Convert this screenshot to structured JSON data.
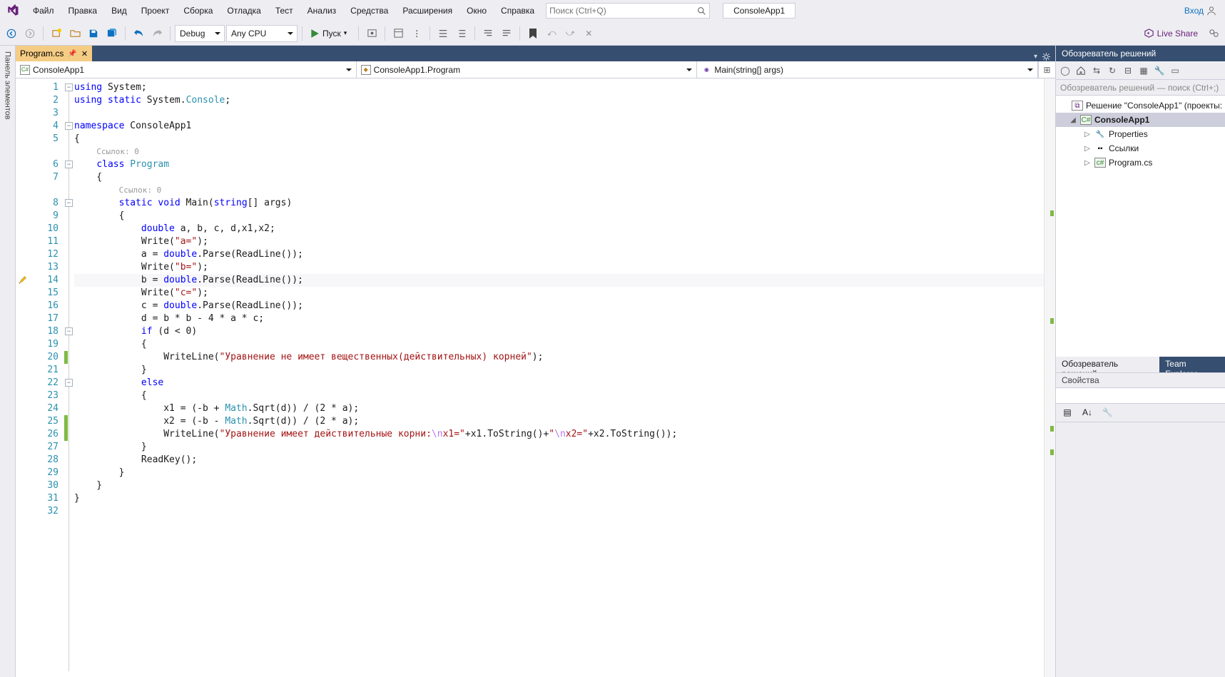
{
  "menu": {
    "items": [
      "Файл",
      "Правка",
      "Вид",
      "Проект",
      "Сборка",
      "Отладка",
      "Тест",
      "Анализ",
      "Средства",
      "Расширения",
      "Окно",
      "Справка"
    ]
  },
  "search": {
    "placeholder": "Поиск (Ctrl+Q)"
  },
  "project_box": "ConsoleApp1",
  "login": "Вход",
  "toolbar": {
    "config": "Debug",
    "platform": "Any CPU",
    "start": "Пуск",
    "liveshare": "Live Share"
  },
  "left_strip": "Панель элементов",
  "tab": {
    "file": "Program.cs"
  },
  "nav": {
    "scope": "ConsoleApp1",
    "class": "ConsoleApp1.Program",
    "member": "Main(string[] args)"
  },
  "codelens": "Ссылок: 0",
  "code_lines": [
    {
      "n": 1,
      "html": "<span class='kw'>using</span> System;"
    },
    {
      "n": 2,
      "html": "<span class='kw'>using</span> <span class='kw'>static</span> System.<span class='type'>Console</span>;"
    },
    {
      "n": 3,
      "html": ""
    },
    {
      "n": 4,
      "html": "<span class='kw'>namespace</span> ConsoleApp1"
    },
    {
      "n": 5,
      "html": "{"
    },
    {
      "n": 0,
      "html": "    <span class='codelens'>Ссылок: 0</span>",
      "lens": true
    },
    {
      "n": 6,
      "html": "    <span class='kw'>class</span> <span class='type'>Program</span>"
    },
    {
      "n": 7,
      "html": "    {"
    },
    {
      "n": 0,
      "html": "        <span class='codelens'>Ссылок: 0</span>",
      "lens": true
    },
    {
      "n": 8,
      "html": "        <span class='kw'>static</span> <span class='kw'>void</span> Main(<span class='kw'>string</span>[] args)"
    },
    {
      "n": 9,
      "html": "        {"
    },
    {
      "n": 10,
      "html": "            <span class='kw'>double</span> a, b, c, d,x1,x2;"
    },
    {
      "n": 11,
      "html": "            Write(<span class='str'>\"a=\"</span>);"
    },
    {
      "n": 12,
      "html": "            a = <span class='kw'>double</span>.Parse(ReadLine());"
    },
    {
      "n": 13,
      "html": "            Write(<span class='str'>\"b=\"</span>);"
    },
    {
      "n": 14,
      "html": "            b = <span class='kw'>double</span>.Parse(ReadLine());",
      "current": true,
      "brush": true
    },
    {
      "n": 15,
      "html": "            Write(<span class='str'>\"c=\"</span>);"
    },
    {
      "n": 16,
      "html": "            c = <span class='kw'>double</span>.Parse(ReadLine());"
    },
    {
      "n": 17,
      "html": "            d = b * b - 4 * a * c;"
    },
    {
      "n": 18,
      "html": "            <span class='kw'>if</span> (d &lt; 0)"
    },
    {
      "n": 19,
      "html": "            {"
    },
    {
      "n": 20,
      "html": "                WriteLine(<span class='str'>\"Уравнение не имеет вещественных(действительных) корней\"</span>);",
      "changed": true
    },
    {
      "n": 21,
      "html": "            }"
    },
    {
      "n": 22,
      "html": "            <span class='kw'>else</span>"
    },
    {
      "n": 23,
      "html": "            {"
    },
    {
      "n": 24,
      "html": "                x1 = (-b + <span class='type'>Math</span>.Sqrt(d)) / (2 * a);"
    },
    {
      "n": 25,
      "html": "                x2 = (-b - <span class='type'>Math</span>.Sqrt(d)) / (2 * a);",
      "changed": true
    },
    {
      "n": 26,
      "html": "                WriteLine(<span class='str'>\"Уравнение имеет действительные корни:<span class='esc'>\\n</span>x1=\"</span>+x1.ToString()+<span class='str'>\"<span class='esc'>\\n</span>x2=\"</span>+x2.ToString());",
      "changed": true
    },
    {
      "n": 27,
      "html": "            }"
    },
    {
      "n": 28,
      "html": "            ReadKey();"
    },
    {
      "n": 29,
      "html": "        }"
    },
    {
      "n": 30,
      "html": "    }"
    },
    {
      "n": 31,
      "html": "}"
    },
    {
      "n": 32,
      "html": ""
    }
  ],
  "fold_lines": [
    1,
    4,
    6,
    8,
    18,
    22
  ],
  "solution_explorer": {
    "title": "Обозреватель решений",
    "search": "Обозреватель решений — поиск (Ctrl+;)",
    "root": "Решение \"ConsoleApp1\" (проекты:",
    "project": "ConsoleApp1",
    "properties": "Properties",
    "references": "Ссылки",
    "file": "Program.cs"
  },
  "bottom_tabs": {
    "a": "Обозреватель решений",
    "b": "Team Explorer"
  },
  "properties": {
    "title": "Свойства"
  }
}
